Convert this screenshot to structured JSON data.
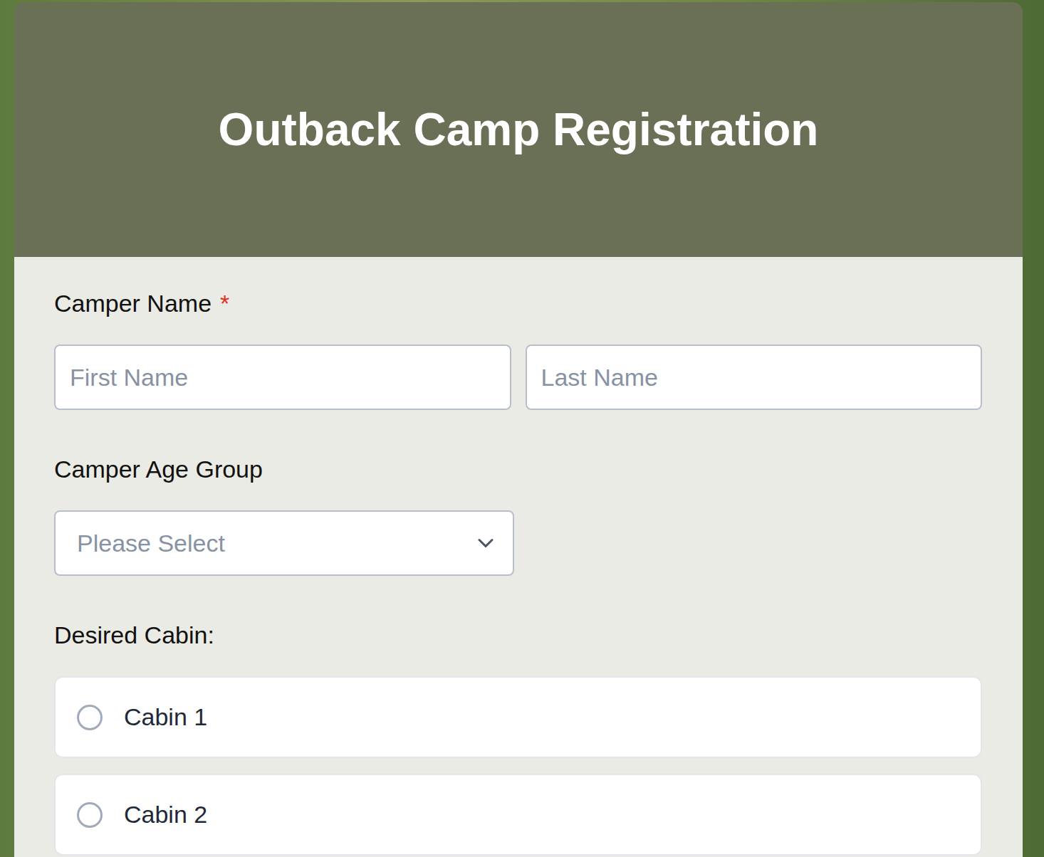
{
  "form": {
    "title": "Outback Camp Registration"
  },
  "name_field": {
    "label": "Camper Name",
    "required_mark": "*",
    "required": true,
    "first_placeholder": "First Name",
    "last_placeholder": "Last Name"
  },
  "age_field": {
    "label": "Camper Age Group",
    "placeholder": "Please Select"
  },
  "cabin_field": {
    "label": "Desired Cabin:",
    "options": [
      {
        "label": "Cabin 1",
        "selected": false
      },
      {
        "label": "Cabin 2",
        "selected": false
      }
    ]
  }
}
